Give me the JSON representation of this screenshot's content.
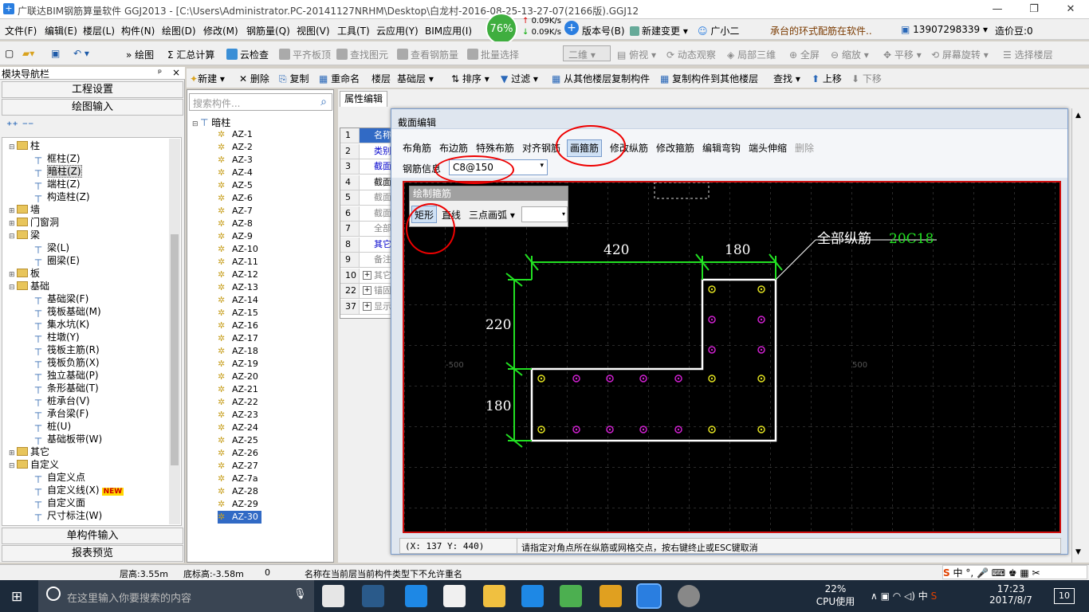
{
  "window": {
    "title": "广联达BIM钢筋算量软件 GGJ2013 - [C:\\Users\\Administrator.PC-20141127NRHM\\Desktop\\白龙村-2016-08-25-13-27-07(2166版).GGJ12]",
    "minimize": "—",
    "restore": "❐",
    "close": "✕"
  },
  "menu": [
    "文件(F)",
    "编辑(E)",
    "楼层(L)",
    "构件(N)",
    "绘图(D)",
    "修改(M)",
    "钢筋量(Q)",
    "视图(V)",
    "工具(T)",
    "云应用(Y)",
    "BIM应用(I)"
  ],
  "menu_right": {
    "version": "版本号(B)",
    "new_change": "新建变更",
    "guangxiao": "广小二",
    "notice": "承台的环式配筋在软件..",
    "phone": "13907298339",
    "price_bean": "造价豆:0"
  },
  "network": {
    "percent": "76%",
    "up": "0.09K/s",
    "down": "0.09K/s"
  },
  "toolbar1": {
    "draw": "绘图",
    "sum": "汇总计算",
    "cloud_check": "云检查",
    "flat_top": "平齐板顶",
    "find_element": "查找图元",
    "view_rebar": "查看钢筋量",
    "batch_select": "批量选择",
    "view_mode": "二维",
    "top_view": "俯视",
    "dynamic": "动态观察",
    "local3d": "局部三维",
    "fullscreen": "全屏",
    "zoom": "缩放",
    "pan": "平移",
    "rotate": "屏幕旋转",
    "select_floor": "选择楼层"
  },
  "left_panel": {
    "header": "模块导航栏",
    "pin": "ᵖ",
    "close": "×",
    "project_settings": "工程设置",
    "drawing_input": "绘图输入",
    "single_input": "单构件输入",
    "report_preview": "报表预览",
    "tree": [
      {
        "level": 0,
        "toggle": "⊟",
        "type": "folder",
        "label": "柱"
      },
      {
        "level": 1,
        "type": "comp",
        "label": "框柱(Z)"
      },
      {
        "level": 1,
        "type": "comp",
        "label": "暗柱(Z)",
        "selected": true
      },
      {
        "level": 1,
        "type": "comp",
        "label": "端柱(Z)"
      },
      {
        "level": 1,
        "type": "comp",
        "label": "构造柱(Z)"
      },
      {
        "level": 0,
        "toggle": "⊞",
        "type": "folder",
        "label": "墙"
      },
      {
        "level": 0,
        "toggle": "⊞",
        "type": "folder",
        "label": "门窗洞"
      },
      {
        "level": 0,
        "toggle": "⊟",
        "type": "folder",
        "label": "梁"
      },
      {
        "level": 1,
        "type": "comp",
        "label": "梁(L)"
      },
      {
        "level": 1,
        "type": "comp",
        "label": "圈梁(E)"
      },
      {
        "level": 0,
        "toggle": "⊞",
        "type": "folder",
        "label": "板"
      },
      {
        "level": 0,
        "toggle": "⊟",
        "type": "folder",
        "label": "基础"
      },
      {
        "level": 1,
        "type": "comp",
        "label": "基础梁(F)"
      },
      {
        "level": 1,
        "type": "comp",
        "label": "筏板基础(M)"
      },
      {
        "level": 1,
        "type": "comp",
        "label": "集水坑(K)"
      },
      {
        "level": 1,
        "type": "comp",
        "label": "柱墩(Y)"
      },
      {
        "level": 1,
        "type": "comp",
        "label": "筏板主筋(R)"
      },
      {
        "level": 1,
        "type": "comp",
        "label": "筏板负筋(X)"
      },
      {
        "level": 1,
        "type": "comp",
        "label": "独立基础(P)"
      },
      {
        "level": 1,
        "type": "comp",
        "label": "条形基础(T)"
      },
      {
        "level": 1,
        "type": "comp",
        "label": "桩承台(V)"
      },
      {
        "level": 1,
        "type": "comp",
        "label": "承台梁(F)"
      },
      {
        "level": 1,
        "type": "comp",
        "label": "桩(U)"
      },
      {
        "level": 1,
        "type": "comp",
        "label": "基础板带(W)"
      },
      {
        "level": 0,
        "toggle": "⊞",
        "type": "folder",
        "label": "其它"
      },
      {
        "level": 0,
        "toggle": "⊟",
        "type": "folder",
        "label": "自定义"
      },
      {
        "level": 1,
        "type": "comp",
        "label": "自定义点"
      },
      {
        "level": 1,
        "type": "comp",
        "label": "自定义线(X)",
        "badge": "NEW"
      },
      {
        "level": 1,
        "type": "comp",
        "label": "自定义面"
      },
      {
        "level": 1,
        "type": "comp",
        "label": "尺寸标注(W)"
      }
    ]
  },
  "toolbar2": {
    "new": "新建",
    "delete": "删除",
    "copy": "复制",
    "rename": "重命名",
    "floor_label": "楼层",
    "floor_value": "基础层",
    "sort": "排序",
    "filter": "过滤",
    "copy_from": "从其他楼层复制构件",
    "copy_to": "复制构件到其他楼层",
    "find": "查找",
    "move_up": "上移",
    "move_down": "下移"
  },
  "component_list": {
    "search_placeholder": "搜索构件...",
    "root": "暗柱",
    "items": [
      "AZ-1",
      "AZ-2",
      "AZ-3",
      "AZ-4",
      "AZ-5",
      "AZ-6",
      "AZ-7",
      "AZ-8",
      "AZ-9",
      "AZ-10",
      "AZ-11",
      "AZ-12",
      "AZ-13",
      "AZ-14",
      "AZ-15",
      "AZ-16",
      "AZ-17",
      "AZ-18",
      "AZ-19",
      "AZ-20",
      "AZ-21",
      "AZ-22",
      "AZ-23",
      "AZ-24",
      "AZ-25",
      "AZ-26",
      "AZ-27",
      "AZ-7a",
      "AZ-28",
      "AZ-29",
      "AZ-30"
    ],
    "selected": "AZ-30"
  },
  "properties": {
    "tab": "属性编辑",
    "rows": [
      {
        "n": "1",
        "label": "名称"
      },
      {
        "n": "2",
        "label": "类别"
      },
      {
        "n": "3",
        "label": "截面"
      },
      {
        "n": "4",
        "label": "截面"
      },
      {
        "n": "5",
        "label": "截面"
      },
      {
        "n": "6",
        "label": "截面"
      },
      {
        "n": "7",
        "label": "全部"
      },
      {
        "n": "8",
        "label": "其它"
      },
      {
        "n": "9",
        "label": "备注"
      },
      {
        "n": "10",
        "label": "其它",
        "expand": "+"
      },
      {
        "n": "22",
        "label": "锚固",
        "expand": "+"
      },
      {
        "n": "37",
        "label": "显示",
        "expand": "+"
      }
    ]
  },
  "section_dialog": {
    "title": "截面编辑",
    "buttons": [
      "布角筋",
      "布边筋",
      "特殊布筋",
      "对齐钢筋",
      "画箍筋",
      "修改纵筋",
      "修改箍筋",
      "编辑弯钩",
      "端头伸缩",
      "删除"
    ],
    "rebar_info_label": "钢筋信息",
    "rebar_info_value": "C8@150",
    "draw_stirrup": {
      "title": "绘制箍筋",
      "rect": "矩形",
      "line": "直线",
      "arc": "三点画弧"
    },
    "canvas": {
      "dim_top_left": "420",
      "dim_top_right": "180",
      "dim_left_top": "220",
      "dim_left_bottom": "180",
      "all_long_label": "全部纵筋",
      "all_long_value": "20C18",
      "axis_left": "-500",
      "axis_right": "500",
      "axis_mid": "0"
    },
    "coords": "(X: 137 Y: 440)",
    "prompt": "请指定对角点所在纵筋或网格交点，按右键终止或ESC键取消"
  },
  "status_bar": {
    "floor_height": "层高:3.55m",
    "bottom_height": "底标高:-3.58m",
    "zero": "0",
    "message": "名称在当前层当前构件类型下不允许重名"
  },
  "taskbar": {
    "search_placeholder": "在这里输入你要搜索的内容",
    "cpu_percent": "22%",
    "cpu_label": "CPU使用",
    "ime": "中",
    "time": "17:23",
    "date": "2017/8/7",
    "notif_count": "10"
  },
  "colors": {
    "accent": "#316ac5",
    "canvas_bg": "#000000",
    "dimension": "#22e022",
    "rebar_corner": "#e0e020",
    "rebar_side": "#d020d0",
    "circle_mark": "#e00000"
  }
}
